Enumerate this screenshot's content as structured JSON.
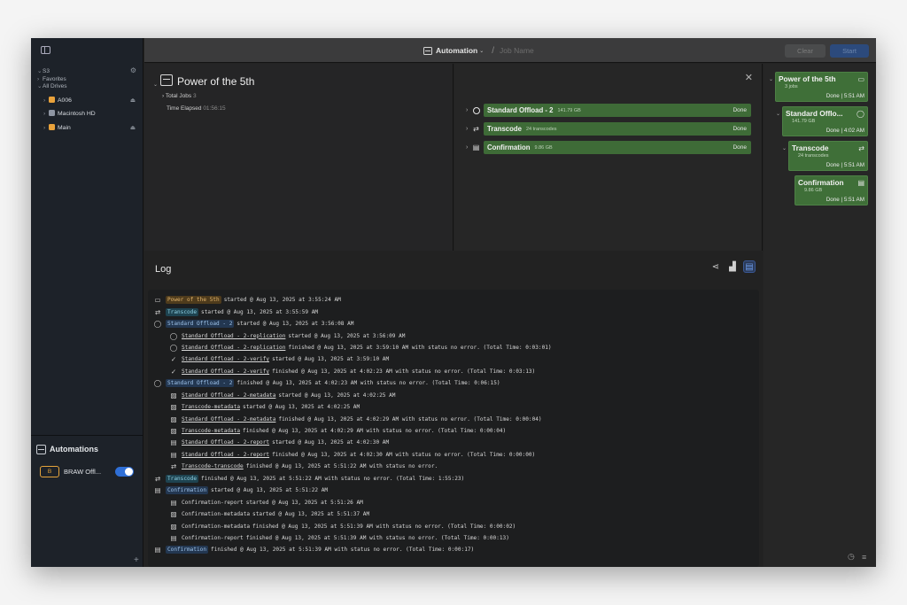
{
  "sidebar": {
    "s3": "S3",
    "favorites": "Favorites",
    "all_drives": "All Drives",
    "drives": [
      {
        "name": "A006",
        "color": "#e9a23b",
        "eject": true
      },
      {
        "name": "Macintosh HD",
        "color": "#8f96a3",
        "eject": false
      },
      {
        "name": "Main",
        "color": "#e9a23b",
        "eject": true
      }
    ],
    "automations_title": "Automations",
    "automation_item": {
      "badge": "B",
      "label": "BRAW Offl...",
      "enabled": true
    },
    "add": "+"
  },
  "toolbar": {
    "title": "Automation",
    "slash": "/",
    "job_placeholder": "Job Name",
    "clear": "Clear",
    "start": "Start"
  },
  "job": {
    "title": "Power of the 5th",
    "total_jobs_label": "Total Jobs",
    "total_jobs": "3",
    "elapsed_label": "Time Elapsed",
    "elapsed": "01:56:15"
  },
  "steps": [
    {
      "name": "Standard Offload - 2",
      "sub": "141.79 GB",
      "status": "Done",
      "icon": "ring"
    },
    {
      "name": "Transcode",
      "sub": "24 transcodes",
      "status": "Done",
      "icon": "⇄"
    },
    {
      "name": "Confirmation",
      "sub": "9.86 GB",
      "status": "Done",
      "icon": "▤"
    }
  ],
  "cards": [
    {
      "title": "Power of the 5th",
      "sub": "3 jobs",
      "status": "Done | 5:51 AM",
      "icon": "▭"
    },
    {
      "title": "Standard Offlo...",
      "sub": "141.79 GB",
      "status": "Done | 4:02 AM",
      "icon": "◯"
    },
    {
      "title": "Transcode",
      "sub": "24 transcodes",
      "status": "Done | 5:51 AM",
      "icon": "⇄"
    },
    {
      "title": "Confirmation",
      "sub": "9.86 GB",
      "status": "Done | 5:51 AM",
      "icon": "▤"
    }
  ],
  "log": {
    "title": "Log",
    "lines": [
      {
        "level": 0,
        "icon": "▭",
        "tag": "Power of the 5th",
        "tag_style": "orange",
        "text": "started @ Aug 13, 2025 at 3:55:24 AM"
      },
      {
        "level": 0,
        "icon": "⇄",
        "tag": "Transcode",
        "tag_style": "teal",
        "text": "started @ Aug 13, 2025 at 3:55:59 AM"
      },
      {
        "level": 0,
        "icon": "◯",
        "tag": "Standard Offload - 2",
        "tag_style": "blue",
        "text": "started @ Aug 13, 2025 at 3:56:08 AM"
      },
      {
        "level": 1,
        "icon": "◯",
        "und": "Standard Offload - 2-replication",
        "text": "started @ Aug 13, 2025 at 3:56:09 AM"
      },
      {
        "level": 1,
        "icon": "◯",
        "und": "Standard Offload - 2-replication",
        "text": "finished @ Aug 13, 2025 at 3:59:10 AM with status no error. (Total Time: 0:03:01)"
      },
      {
        "level": 1,
        "icon": "✓",
        "und": "Standard Offload - 2-verify",
        "text": "started @ Aug 13, 2025 at 3:59:10 AM"
      },
      {
        "level": 1,
        "icon": "✓",
        "und": "Standard Offload - 2-verify",
        "text": "finished @ Aug 13, 2025 at 4:02:23 AM with status no error. (Total Time: 0:03:13)"
      },
      {
        "level": 0,
        "icon": "◯",
        "tag": "Standard Offload - 2",
        "tag_style": "blue",
        "text": "finished @ Aug 13, 2025 at 4:02:23 AM with status no error. (Total Time: 0:06:15)"
      },
      {
        "level": 1,
        "icon": "▨",
        "und": "Standard Offload - 2-metadata",
        "text": "started @ Aug 13, 2025 at 4:02:25 AM"
      },
      {
        "level": 1,
        "icon": "▨",
        "und": "Transcode-metadata",
        "text": "started @ Aug 13, 2025 at 4:02:25 AM"
      },
      {
        "level": 1,
        "icon": "▨",
        "und": "Standard Offload - 2-metadata",
        "text": "finished @ Aug 13, 2025 at 4:02:29 AM with status no error. (Total Time: 0:00:04)"
      },
      {
        "level": 1,
        "icon": "▨",
        "und": "Transcode-metadata",
        "text": "finished @ Aug 13, 2025 at 4:02:29 AM with status no error. (Total Time: 0:00:04)"
      },
      {
        "level": 1,
        "icon": "▤",
        "und": "Standard Offload - 2-report",
        "text": "started @ Aug 13, 2025 at 4:02:30 AM"
      },
      {
        "level": 1,
        "icon": "▤",
        "und": "Standard Offload - 2-report",
        "text": "finished @ Aug 13, 2025 at 4:02:30 AM with status no error. (Total Time: 0:00:00)"
      },
      {
        "level": 1,
        "icon": "⇄",
        "und": "Transcode-transcode",
        "text": "finished @ Aug 13, 2025 at 5:51:22 AM with status no error."
      },
      {
        "level": 0,
        "icon": "⇄",
        "tag": "Transcode",
        "tag_style": "teal",
        "text": "finished @ Aug 13, 2025 at 5:51:22 AM with status no error. (Total Time: 1:55:23)"
      },
      {
        "level": 0,
        "icon": "▤",
        "tag": "Confirmation",
        "tag_style": "blue",
        "text": "started @ Aug 13, 2025 at 5:51:22 AM"
      },
      {
        "level": 1,
        "icon": "▤",
        "plain": "Confirmation-report",
        "text": "started @ Aug 13, 2025 at 5:51:26 AM"
      },
      {
        "level": 1,
        "icon": "▨",
        "plain": "Confirmation-metadata",
        "text": "started @ Aug 13, 2025 at 5:51:37 AM"
      },
      {
        "level": 1,
        "icon": "▨",
        "plain": "Confirmation-metadata",
        "text": "finished @ Aug 13, 2025 at 5:51:39 AM with status no error. (Total Time: 0:00:02)"
      },
      {
        "level": 1,
        "icon": "▤",
        "plain": "Confirmation-report",
        "text": "finished @ Aug 13, 2025 at 5:51:39 AM with status no error. (Total Time: 0:00:13)"
      },
      {
        "level": 0,
        "icon": "▤",
        "tag": "Confirmation",
        "tag_style": "blue",
        "text": "finished @ Aug 13, 2025 at 5:51:39 AM with status no error. (Total Time: 0:00:17)"
      }
    ]
  }
}
